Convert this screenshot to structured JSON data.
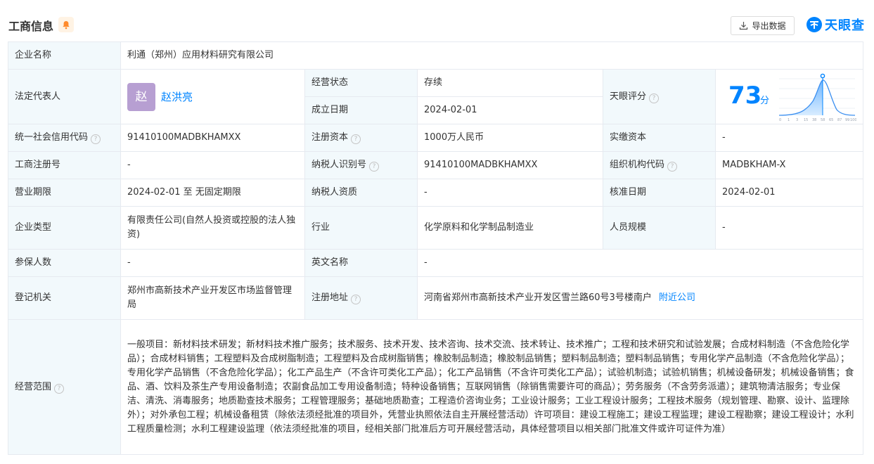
{
  "header": {
    "title": "工商信息",
    "export_label": "导出数据",
    "logo_text": "天眼查"
  },
  "company": {
    "name_label": "企业名称",
    "name": "利通（郑州）应用材料研究有限公司",
    "legal_rep_label": "法定代表人",
    "legal_rep_avatar": "赵",
    "legal_rep_name": "赵洪亮",
    "status_label": "经营状态",
    "status": "存续",
    "founded_label": "成立日期",
    "founded": "2024-02-01",
    "score_label": "天眼评分",
    "score": "73",
    "score_unit": "分",
    "score_ticks": [
      "0",
      "1",
      "3",
      "15",
      "38",
      "58",
      "65",
      "87",
      "99",
      "100"
    ],
    "credit_code_label": "统一社会信用代码",
    "credit_code": "91410100MADBKHAMXX",
    "reg_capital_label": "注册资本",
    "reg_capital": "1000万人民币",
    "paid_capital_label": "实缴资本",
    "paid_capital": "-",
    "reg_no_label": "工商注册号",
    "reg_no": "-",
    "taxpayer_id_label": "纳税人识别号",
    "taxpayer_id": "91410100MADBKHAMXX",
    "org_code_label": "组织机构代码",
    "org_code": "MADBKHAM-X",
    "term_label": "营业期限",
    "term": "2024-02-01 至 无固定期限",
    "taxpayer_qual_label": "纳税人资质",
    "taxpayer_qual": "-",
    "approval_date_label": "核准日期",
    "approval_date": "2024-02-01",
    "type_label": "企业类型",
    "type": "有限责任公司(自然人投资或控股的法人独资)",
    "industry_label": "行业",
    "industry": "化学原料和化学制品制造业",
    "staff_size_label": "人员规模",
    "staff_size": "-",
    "insured_label": "参保人数",
    "insured": "-",
    "english_name_label": "英文名称",
    "english_name": "-",
    "reg_authority_label": "登记机关",
    "reg_authority": "郑州市高新技术产业开发区市场监督管理局",
    "address_label": "注册地址",
    "address": "河南省郑州市高新技术产业开发区雪兰路60号3号楼南户",
    "nearby_label": "附近公司",
    "scope_label": "经营范围",
    "scope": "一般项目：新材料技术研发；新材料技术推广服务；技术服务、技术开发、技术咨询、技术交流、技术转让、技术推广；工程和技术研究和试验发展；合成材料制造（不含危险化学品）；合成材料销售；工程塑料及合成树脂制造；工程塑料及合成树脂销售；橡胶制品制造；橡胶制品销售；塑料制品制造；塑料制品销售；专用化学产品制造（不含危险化学品）；专用化学产品销售（不含危险化学品）；化工产品生产（不含许可类化工产品）；化工产品销售（不含许可类化工产品）；试验机制造；试验机销售；机械设备研发；机械设备销售；食品、酒、饮料及茶生产专用设备制造；农副食品加工专用设备制造；特种设备销售；互联网销售（除销售需要许可的商品）；劳务服务（不含劳务派遣）；建筑物清洁服务；专业保洁、清洗、消毒服务；地质勘查技术服务；工程管理服务；基础地质勘查；工程造价咨询业务；工业设计服务；工业工程设计服务；工程技术服务（规划管理、勘察、设计、监理除外）；对外承包工程；机械设备租赁（除依法须经批准的项目外，凭营业执照依法自主开展经营活动）许可项目：建设工程施工；建设工程监理；建设工程勘察；建设工程设计；水利工程质量检测；水利工程建设监理（依法须经批准的项目，经相关部门批准后方可开展经营活动，具体经营项目以相关部门批准文件或许可证件为准）"
  },
  "colors": {
    "accent": "#0084ff",
    "status_green": "#13c28d",
    "label_bg": "#f2f9fc",
    "avatar_bg": "#b79fd2"
  }
}
